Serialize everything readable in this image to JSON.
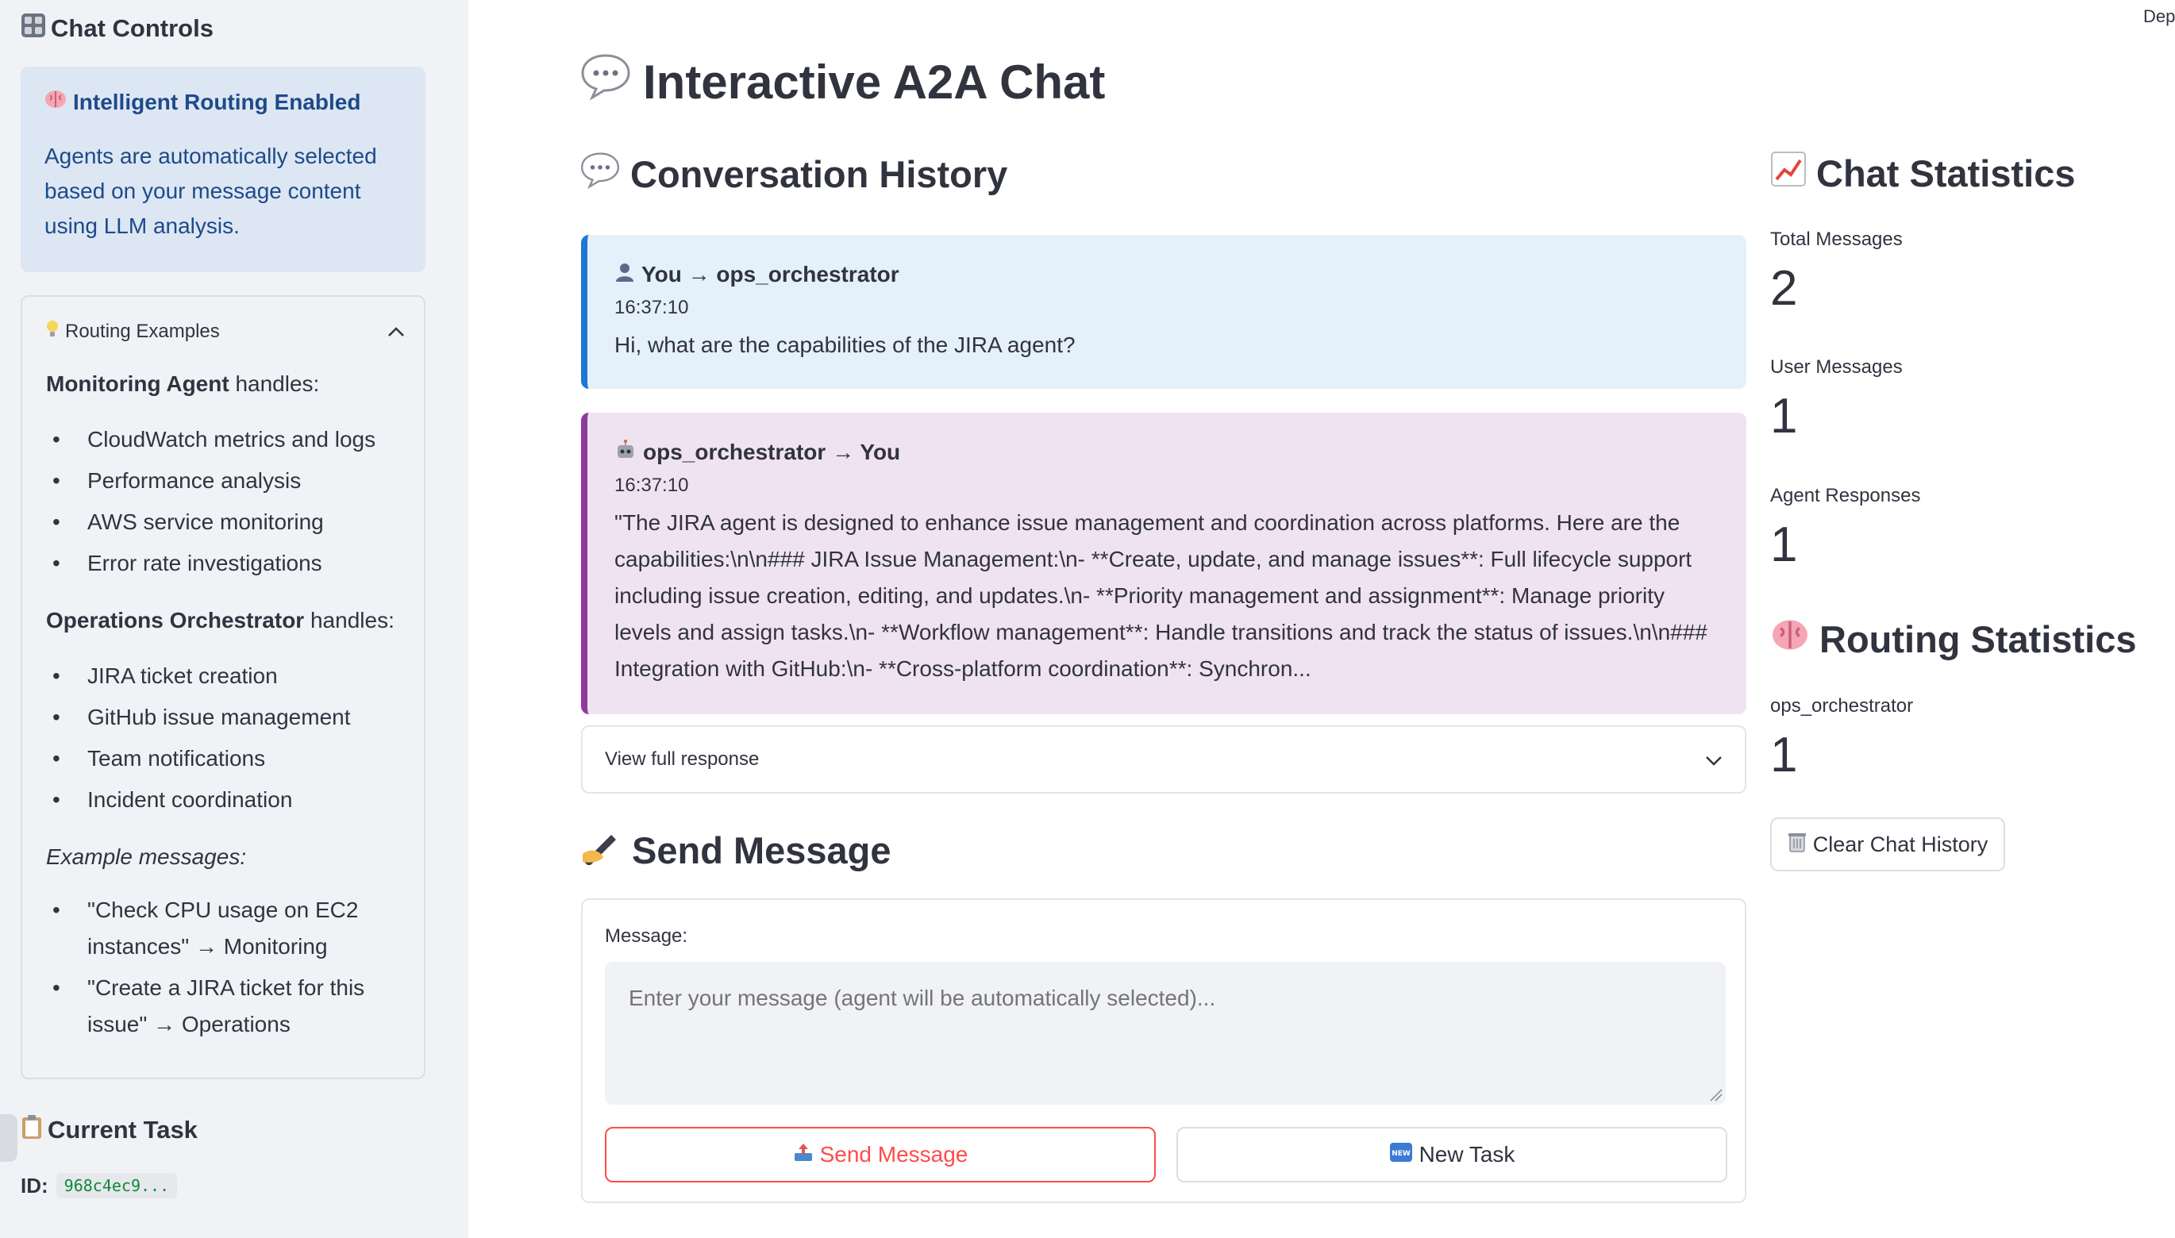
{
  "sidebar": {
    "title": "Chat Controls",
    "title_icon": "control-knobs-icon",
    "info": {
      "heading": "Intelligent Routing Enabled",
      "icon": "brain-icon",
      "body": "Agents are automatically selected based on your message content using LLM analysis."
    },
    "routing": {
      "title": "Routing Examples",
      "icon": "lightbulb-icon",
      "monitoring_name": "Monitoring Agent",
      "handles_text": " handles:",
      "monitoring_items": [
        "CloudWatch metrics and logs",
        "Performance analysis",
        "AWS service monitoring",
        "Error rate investigations"
      ],
      "ops_name": "Operations Orchestrator",
      "ops_items": [
        "JIRA ticket creation",
        "GitHub issue management",
        "Team notifications",
        "Incident coordination"
      ],
      "examples_label": "Example messages:",
      "examples": [
        "\"Check CPU usage on EC2 instances\" → Monitoring",
        "\"Create a JIRA ticket for this issue\" → Operations"
      ]
    },
    "current_task": {
      "title": "Current Task",
      "icon": "clipboard-icon",
      "id_label": "ID:",
      "id_value": "968c4ec9..."
    }
  },
  "header": {
    "deploy_label": "Dep"
  },
  "main": {
    "title": "Interactive A2A Chat",
    "title_icon": "speech-bubble-icon",
    "history_title": "Conversation History",
    "history_icon": "speech-bubble-icon",
    "messages": [
      {
        "role": "user",
        "icon": "user-silhouette-icon",
        "header": "You → ops_orchestrator",
        "time": "16:37:10",
        "text": "Hi, what are the capabilities of the JIRA agent?"
      },
      {
        "role": "agent",
        "icon": "robot-icon",
        "header": "ops_orchestrator → You",
        "time": "16:37:10",
        "text": "\"The JIRA agent is designed to enhance issue management and coordination across platforms. Here are the capabilities:\\n\\n### JIRA Issue Management:\\n- **Create, update, and manage issues**: Full lifecycle support including issue creation, editing, and updates.\\n- **Priority management and assignment**: Manage priority levels and assign tasks.\\n- **Workflow management**: Handle transitions and track the status of issues.\\n\\n### Integration with GitHub:\\n- **Cross-platform coordination**: Synchron..."
      }
    ],
    "view_full_label": "View full response",
    "send_title": "Send Message",
    "send_icon": "writing-hand-icon",
    "form": {
      "message_label": "Message:",
      "placeholder": "Enter your message (agent will be automatically selected)...",
      "send_label": "Send Message",
      "send_icon": "outbox-tray-icon",
      "new_task_label": "New Task",
      "new_task_icon": "new-badge-icon"
    }
  },
  "stats": {
    "title": "Chat Statistics",
    "title_icon": "chart-increasing-icon",
    "total_label": "Total Messages",
    "total_value": "2",
    "user_label": "User Messages",
    "user_value": "1",
    "agent_label": "Agent Responses",
    "agent_value": "1",
    "routing_title": "Routing Statistics",
    "routing_icon": "brain-icon",
    "routing_agent_label": "ops_orchestrator",
    "routing_agent_value": "1",
    "clear_label": "Clear Chat History",
    "clear_icon": "wastebasket-icon"
  },
  "colors": {
    "user_accent": "#1f77d4",
    "agent_accent": "#8e3a9e",
    "primary": "#ff4b4b",
    "info_text": "#1d4a8a"
  }
}
